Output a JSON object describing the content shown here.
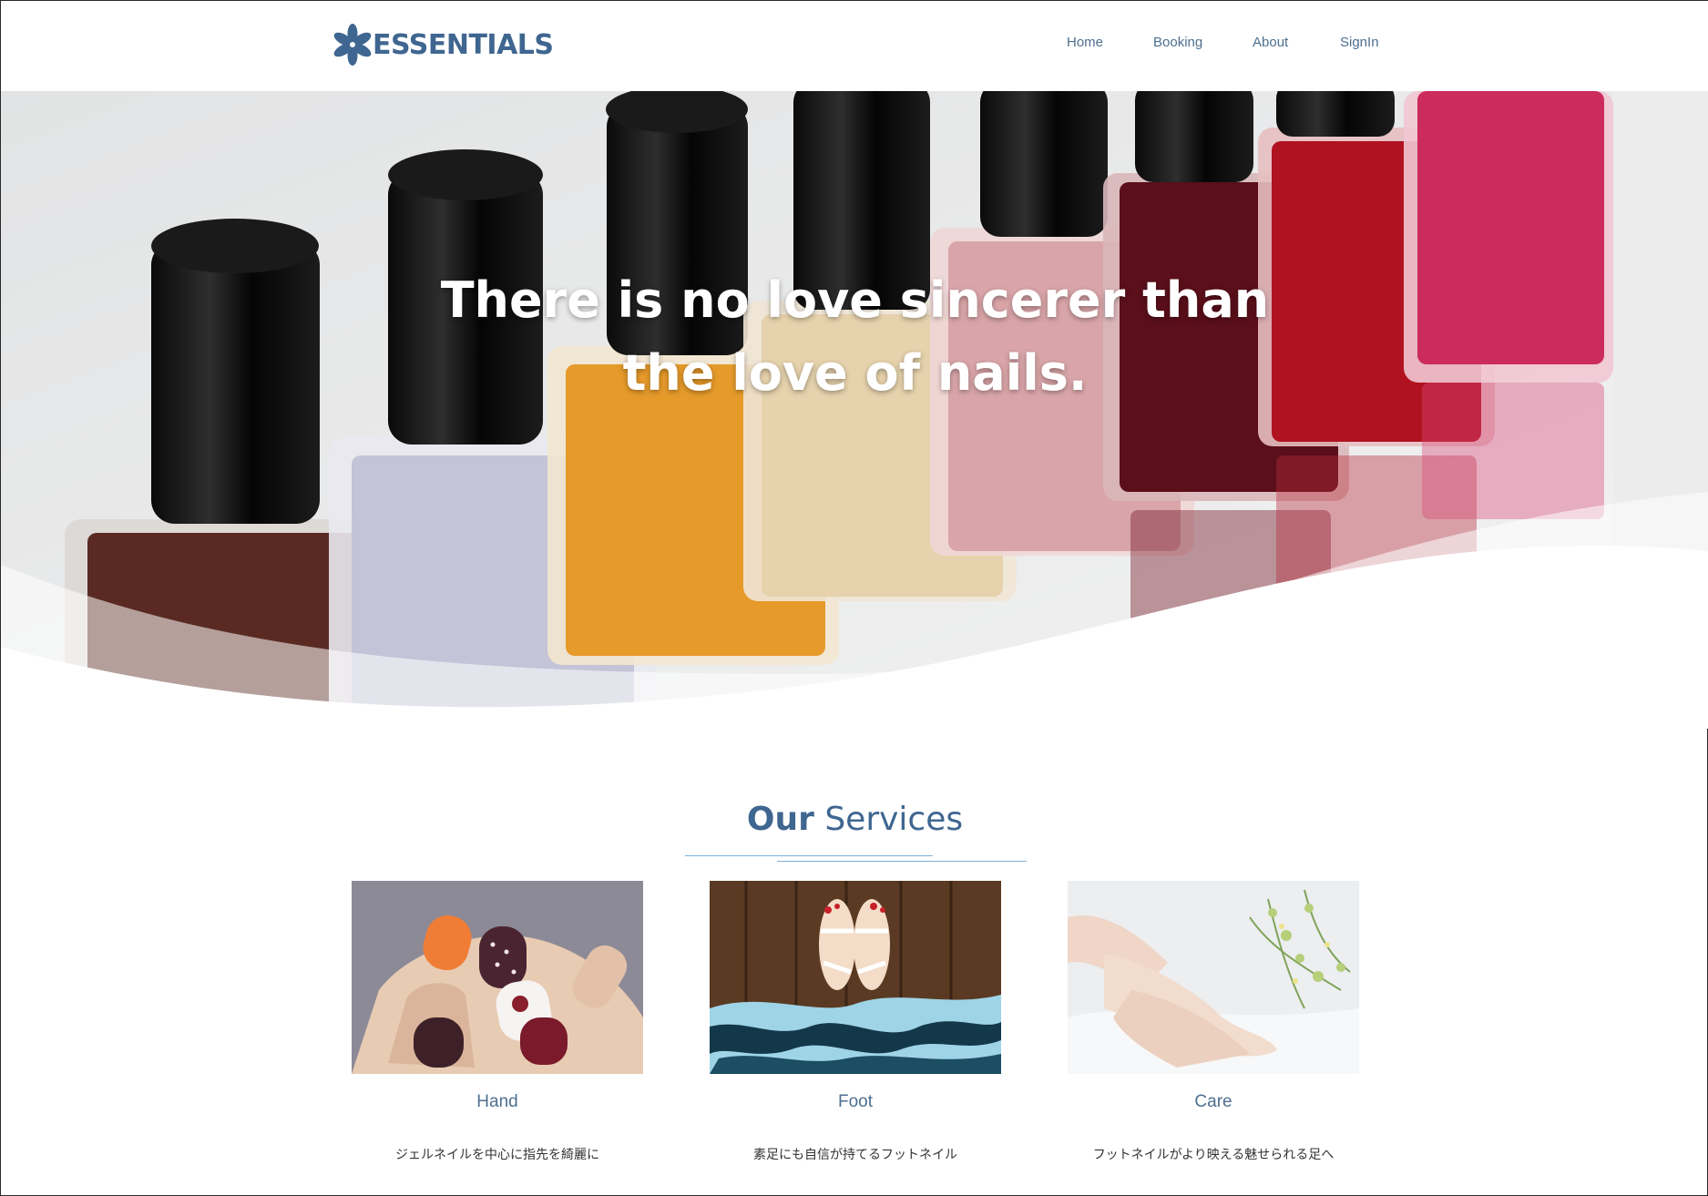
{
  "brand": {
    "name": "ESSENTIALS",
    "color": "#3f6690",
    "icon": "flower-asterisk-icon"
  },
  "nav": {
    "items": [
      {
        "label": "Home"
      },
      {
        "label": "Booking"
      },
      {
        "label": "About"
      },
      {
        "label": "SignIn"
      }
    ]
  },
  "hero": {
    "line1": "There is no love sincerer than",
    "line2": "the love of nails.",
    "image": "nail-polish-bottles-photo"
  },
  "services": {
    "title_strong": "Our",
    "title_rest": "Services",
    "cards": [
      {
        "label": "Hand",
        "desc": "ジェルネイルを中心に指先を綺麗に",
        "image": "painted-fingernails-photo"
      },
      {
        "label": "Foot",
        "desc": "素足にも自信が持てるフットネイル",
        "image": "feet-in-sandals-photo"
      },
      {
        "label": "Care",
        "desc": "フットネイルがより映える魅せられる足へ",
        "image": "foot-care-photo"
      }
    ]
  }
}
